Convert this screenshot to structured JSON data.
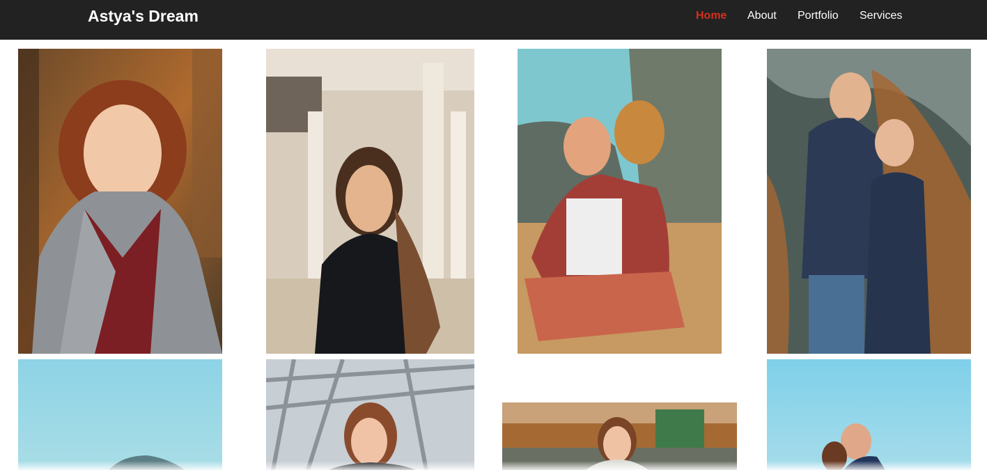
{
  "header": {
    "brand": "Astya's Dream",
    "nav": [
      {
        "label": "Home",
        "active": true
      },
      {
        "label": "About",
        "active": false
      },
      {
        "label": "Portfolio",
        "active": false
      },
      {
        "label": "Services",
        "active": false
      }
    ],
    "colors": {
      "background": "#222222",
      "active": "#d6301b",
      "text": "#ffffff"
    }
  },
  "gallery": {
    "photos": [
      {
        "subject": "Red-haired woman in grey coat, autumn forest"
      },
      {
        "subject": "Long-haired woman in black jacket, museum hall with columns"
      },
      {
        "subject": "Couple hugging, sitting on a seaside hill"
      },
      {
        "subject": "Couple embracing by orange-lichen rock"
      },
      {
        "subject": "Sea and sky with distant island"
      },
      {
        "subject": "Woman under a glass roof structure"
      },
      {
        "subject": "Woman in scarf by an autumn lake"
      },
      {
        "subject": "Couple kissing under blue sky"
      }
    ]
  }
}
